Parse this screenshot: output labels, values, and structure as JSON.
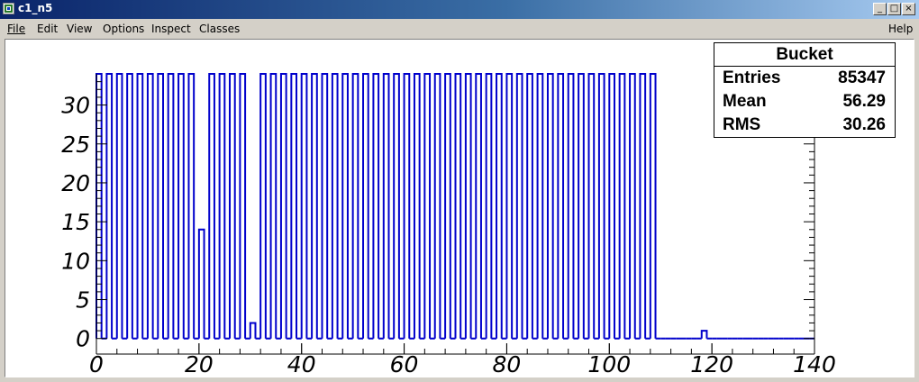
{
  "window": {
    "title": "c1_n5",
    "minimize_glyph": "_",
    "maximize_glyph": "□",
    "close_glyph": "×"
  },
  "menu": {
    "file": "File",
    "edit": "Edit",
    "view": "View",
    "options": "Options",
    "inspect": "Inspect",
    "classes": "Classes",
    "help": "Help"
  },
  "statbox": {
    "title": "Bucket",
    "entries_label": "Entries",
    "entries_value": "85347",
    "mean_label": "Mean",
    "mean_value": "56.29",
    "rms_label": "RMS",
    "rms_value": "30.26"
  },
  "colors": {
    "histogram_line": "#0000cc",
    "axis": "#000000",
    "canvas_bg": "#ffffff",
    "window_bg": "#d4d0c8",
    "titlebar_start": "#0a246a"
  },
  "chart_data": {
    "type": "histogram",
    "title": "",
    "xlabel": "",
    "ylabel": "",
    "xlim": [
      0,
      140
    ],
    "ylim": [
      -2,
      34
    ],
    "x_ticks": [
      0,
      20,
      40,
      60,
      80,
      100,
      120,
      140
    ],
    "y_ticks": [
      0,
      5,
      10,
      15,
      20,
      25,
      30
    ],
    "bin_width": 1,
    "bins_x_low": [
      0,
      1,
      2,
      3,
      4,
      5,
      6,
      7,
      8,
      9,
      10,
      11,
      12,
      13,
      14,
      15,
      16,
      17,
      18,
      19,
      20,
      21,
      22,
      23,
      24,
      25,
      26,
      27,
      28,
      29,
      30,
      31,
      32,
      33,
      34,
      35,
      36,
      37,
      38,
      39,
      40,
      41,
      42,
      43,
      44,
      45,
      46,
      47,
      48,
      49,
      50,
      51,
      52,
      53,
      54,
      55,
      56,
      57,
      58,
      59,
      60,
      61,
      62,
      63,
      64,
      65,
      66,
      67,
      68,
      69,
      70,
      71,
      72,
      73,
      74,
      75,
      76,
      77,
      78,
      79,
      80,
      81,
      82,
      83,
      84,
      85,
      86,
      87,
      88,
      89,
      90,
      91,
      92,
      93,
      94,
      95,
      96,
      97,
      98,
      99,
      100,
      101,
      102,
      103,
      104,
      105,
      106,
      107,
      108,
      109,
      110,
      111,
      112,
      113,
      114,
      115,
      116,
      117,
      118,
      119,
      120,
      121,
      122,
      123,
      124,
      125,
      126,
      127,
      128,
      129,
      130,
      131,
      132,
      133,
      134,
      135,
      136,
      137,
      138,
      139
    ],
    "values": [
      34,
      0,
      34,
      0,
      34,
      0,
      34,
      0,
      34,
      0,
      34,
      0,
      34,
      0,
      34,
      0,
      34,
      0,
      34,
      0,
      14,
      0,
      34,
      0,
      34,
      0,
      34,
      0,
      34,
      0,
      2,
      0,
      34,
      0,
      34,
      0,
      34,
      0,
      34,
      0,
      34,
      0,
      34,
      0,
      34,
      0,
      34,
      0,
      34,
      0,
      34,
      0,
      34,
      0,
      34,
      0,
      34,
      0,
      34,
      0,
      34,
      0,
      34,
      0,
      34,
      0,
      34,
      0,
      34,
      0,
      34,
      0,
      34,
      0,
      34,
      0,
      34,
      0,
      34,
      0,
      34,
      0,
      34,
      0,
      34,
      0,
      34,
      0,
      34,
      0,
      34,
      0,
      34,
      0,
      34,
      0,
      34,
      0,
      34,
      0,
      34,
      0,
      34,
      0,
      34,
      0,
      34,
      0,
      34,
      0,
      0,
      0,
      0,
      0,
      0,
      0,
      0,
      0,
      1,
      0,
      0,
      0,
      0,
      0,
      0,
      0,
      0,
      0,
      0,
      0,
      0,
      0,
      0,
      0,
      0,
      0,
      0,
      0,
      0,
      0
    ],
    "legend_position": "top-right"
  }
}
